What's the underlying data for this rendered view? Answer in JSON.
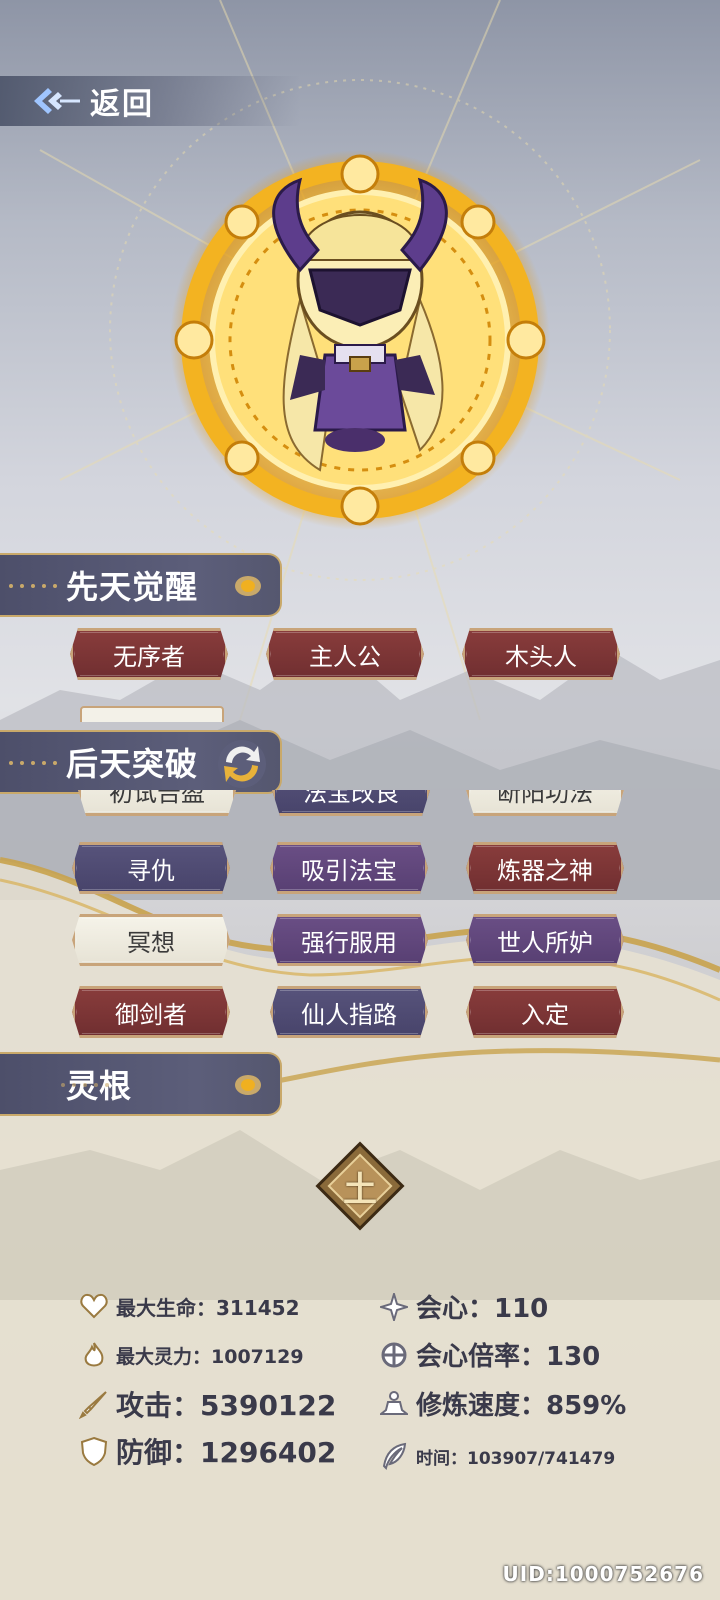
{
  "header": {
    "back_label": "返回"
  },
  "sections": {
    "innate": {
      "title": "先天觉醒"
    },
    "acquired": {
      "title": "后天突破"
    },
    "root": {
      "title": "灵根",
      "element_glyph": "土"
    }
  },
  "innate_traits": [
    {
      "label": "无序者",
      "style": "red"
    },
    {
      "label": "主人公",
      "style": "red"
    },
    {
      "label": "木头人",
      "style": "red"
    }
  ],
  "acquired_traits": [
    {
      "label": "初试告盈",
      "style": "white"
    },
    {
      "label": "法宝改良",
      "style": "purple"
    },
    {
      "label": "断阳功法",
      "style": "white"
    },
    {
      "label": "寻仇",
      "style": "purple"
    },
    {
      "label": "吸引法宝",
      "style": "violet"
    },
    {
      "label": "炼器之神",
      "style": "red"
    },
    {
      "label": "冥想",
      "style": "white"
    },
    {
      "label": "强行服用",
      "style": "violet"
    },
    {
      "label": "世人所妒",
      "style": "violet"
    },
    {
      "label": "御剑者",
      "style": "red"
    },
    {
      "label": "仙人指路",
      "style": "purple"
    },
    {
      "label": "入定",
      "style": "red"
    }
  ],
  "stats": {
    "max_hp": "最大生命：311452",
    "crit": "会心：110",
    "max_mana": "最大灵力：1007129",
    "crit_rate": "会心倍率：130",
    "attack": "攻击：5390122",
    "cultivation_speed": "修炼速度：859%",
    "defense": "防御：1296402",
    "time": "时间：103907/741479"
  },
  "uid": "UID:1000752676",
  "colors": {
    "accent_gold": "#c9a96a",
    "header_purple": "#55576f",
    "trait_red": "#7a3435",
    "trait_purple": "#4f4b73"
  }
}
